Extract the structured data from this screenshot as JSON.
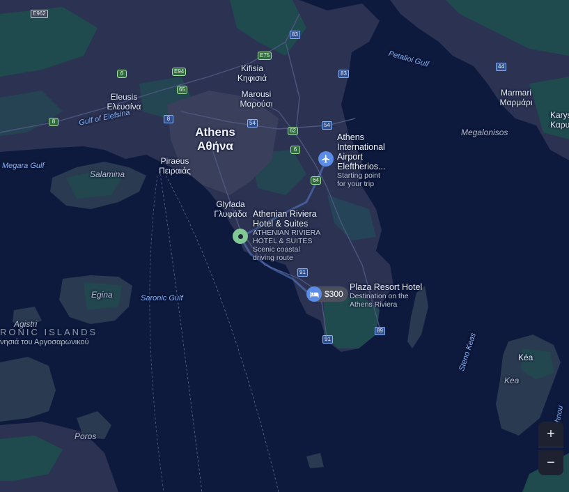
{
  "roads": {
    "e962": "E962",
    "r83a": "83",
    "r83b": "83",
    "e75": "E75",
    "e94": "E94",
    "r6a": "6",
    "r65": "65",
    "r8": "8",
    "r8b": "8",
    "r54a": "54",
    "r62": "62",
    "r54b": "54",
    "r6b": "6",
    "r64": "64",
    "r44": "44",
    "r91a": "91",
    "r91b": "91",
    "r91c": "91",
    "r89": "89"
  },
  "places": {
    "kifisia_en": "Kifisia",
    "kifisia_gr": "Κηφισιά",
    "marousi_en": "Marousi",
    "marousi_gr": "Μαρούσι",
    "eleusis_en": "Eleusis",
    "eleusis_gr": "Ελευσίνα",
    "athens_en": "Athens",
    "athens_gr": "Αθήνα",
    "piraeus_en": "Piraeus",
    "piraeus_gr": "Πειραιάς",
    "glyfada_en": "Glyfada",
    "glyfada_gr": "Γλυφάδα",
    "marmari_en": "Marmari",
    "marmari_gr": "Μαρμάρι",
    "karys_en": "Karys",
    "karys_gr": "Καρυσ",
    "kea_en": "Kéa",
    "kea_it": "Kea",
    "salamina": "Salamina",
    "egina": "Egina",
    "agistri": "Agistri",
    "poros": "Poros",
    "megalonisos": "Megalonisos"
  },
  "water": {
    "petalioi": "Petalioi Gulf",
    "elefsina": "Gulf of Elefsina",
    "megara": "Megara Gulf",
    "saronic": "Saronic Gulf",
    "steno_keas": "Steno Keas",
    "edge_right": "hnou"
  },
  "region": {
    "saronic_en": "RONIC ISLANDS",
    "saronic_gr": "νησιά του Αργοσαρωνικού"
  },
  "pois": {
    "airport": {
      "title_lines": [
        "Athens",
        "International",
        "Airport",
        "Eleftherios..."
      ],
      "subtitle_lines": [
        "Starting point",
        "for your trip"
      ],
      "icon": "airplane-icon"
    },
    "riviera": {
      "title_lines": [
        "Athenian Riviera",
        "Hotel & Suites"
      ],
      "subtitle_lines": [
        "ATHENIAN RIVIERA",
        "HOTEL & SUITES",
        "Scenic coastal",
        "driving route"
      ],
      "icon": "pin-dot-icon"
    },
    "plaza": {
      "title": "Plaza Resort Hotel",
      "subtitle_lines": [
        "Destination on the",
        "Athens Riviera"
      ],
      "price": "$300",
      "icon": "bed-icon"
    }
  },
  "controls": {
    "zoom_in": "+",
    "zoom_out": "−"
  },
  "colors": {
    "sea": "#0d1a3e",
    "land": "#2a3250",
    "green_land": "#1f4a4c",
    "route": "#5b7ec9",
    "accent_blue": "#8ab4f8",
    "pin_green": "#80c995"
  }
}
